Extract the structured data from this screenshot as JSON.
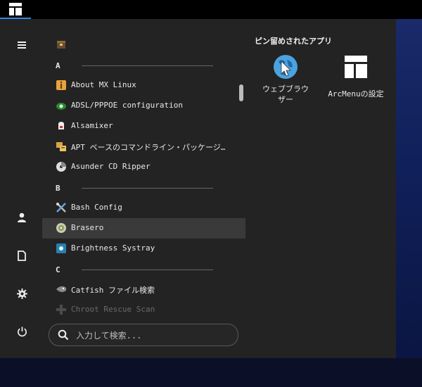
{
  "menu": {
    "list": {
      "top_icon": "package-icon",
      "groups": [
        {
          "letter": "A",
          "items": [
            {
              "label": "About MX Linux",
              "icon": "mx-info-icon"
            },
            {
              "label": "ADSL/PPPOE configuration",
              "icon": "network-icon"
            },
            {
              "label": "Alsamixer",
              "icon": "mixer-icon"
            },
            {
              "label": "APT ベースのコマンドライン・パッケージ管理",
              "icon": "apt-icon"
            },
            {
              "label": "Asunder CD Ripper",
              "icon": "cd-ripper-icon"
            }
          ]
        },
        {
          "letter": "B",
          "items": [
            {
              "label": "Bash Config",
              "icon": "tools-icon"
            },
            {
              "label": "Brasero",
              "icon": "brasero-icon",
              "highlighted": true
            },
            {
              "label": "Brightness Systray",
              "icon": "brightness-icon"
            }
          ]
        },
        {
          "letter": "C",
          "items": [
            {
              "label": "Catfish ファイル検索",
              "icon": "catfish-icon"
            },
            {
              "label": "Chroot Rescue Scan",
              "icon": "rescue-icon"
            }
          ]
        }
      ]
    },
    "search": {
      "placeholder": "入力して検索..."
    },
    "pinned": {
      "title": "ピン留めされたアプリ",
      "apps": [
        {
          "label_line1": "ウェブブラウ",
          "label_line2": "ザー",
          "icon": "web-browser-icon"
        },
        {
          "label_line1": "ArcMenuの設定",
          "label_line2": "",
          "icon": "arcmenu-settings-icon"
        }
      ]
    },
    "sidebar": [
      "hamburger-icon",
      "user-icon",
      "document-icon",
      "settings-icon",
      "power-icon"
    ]
  }
}
